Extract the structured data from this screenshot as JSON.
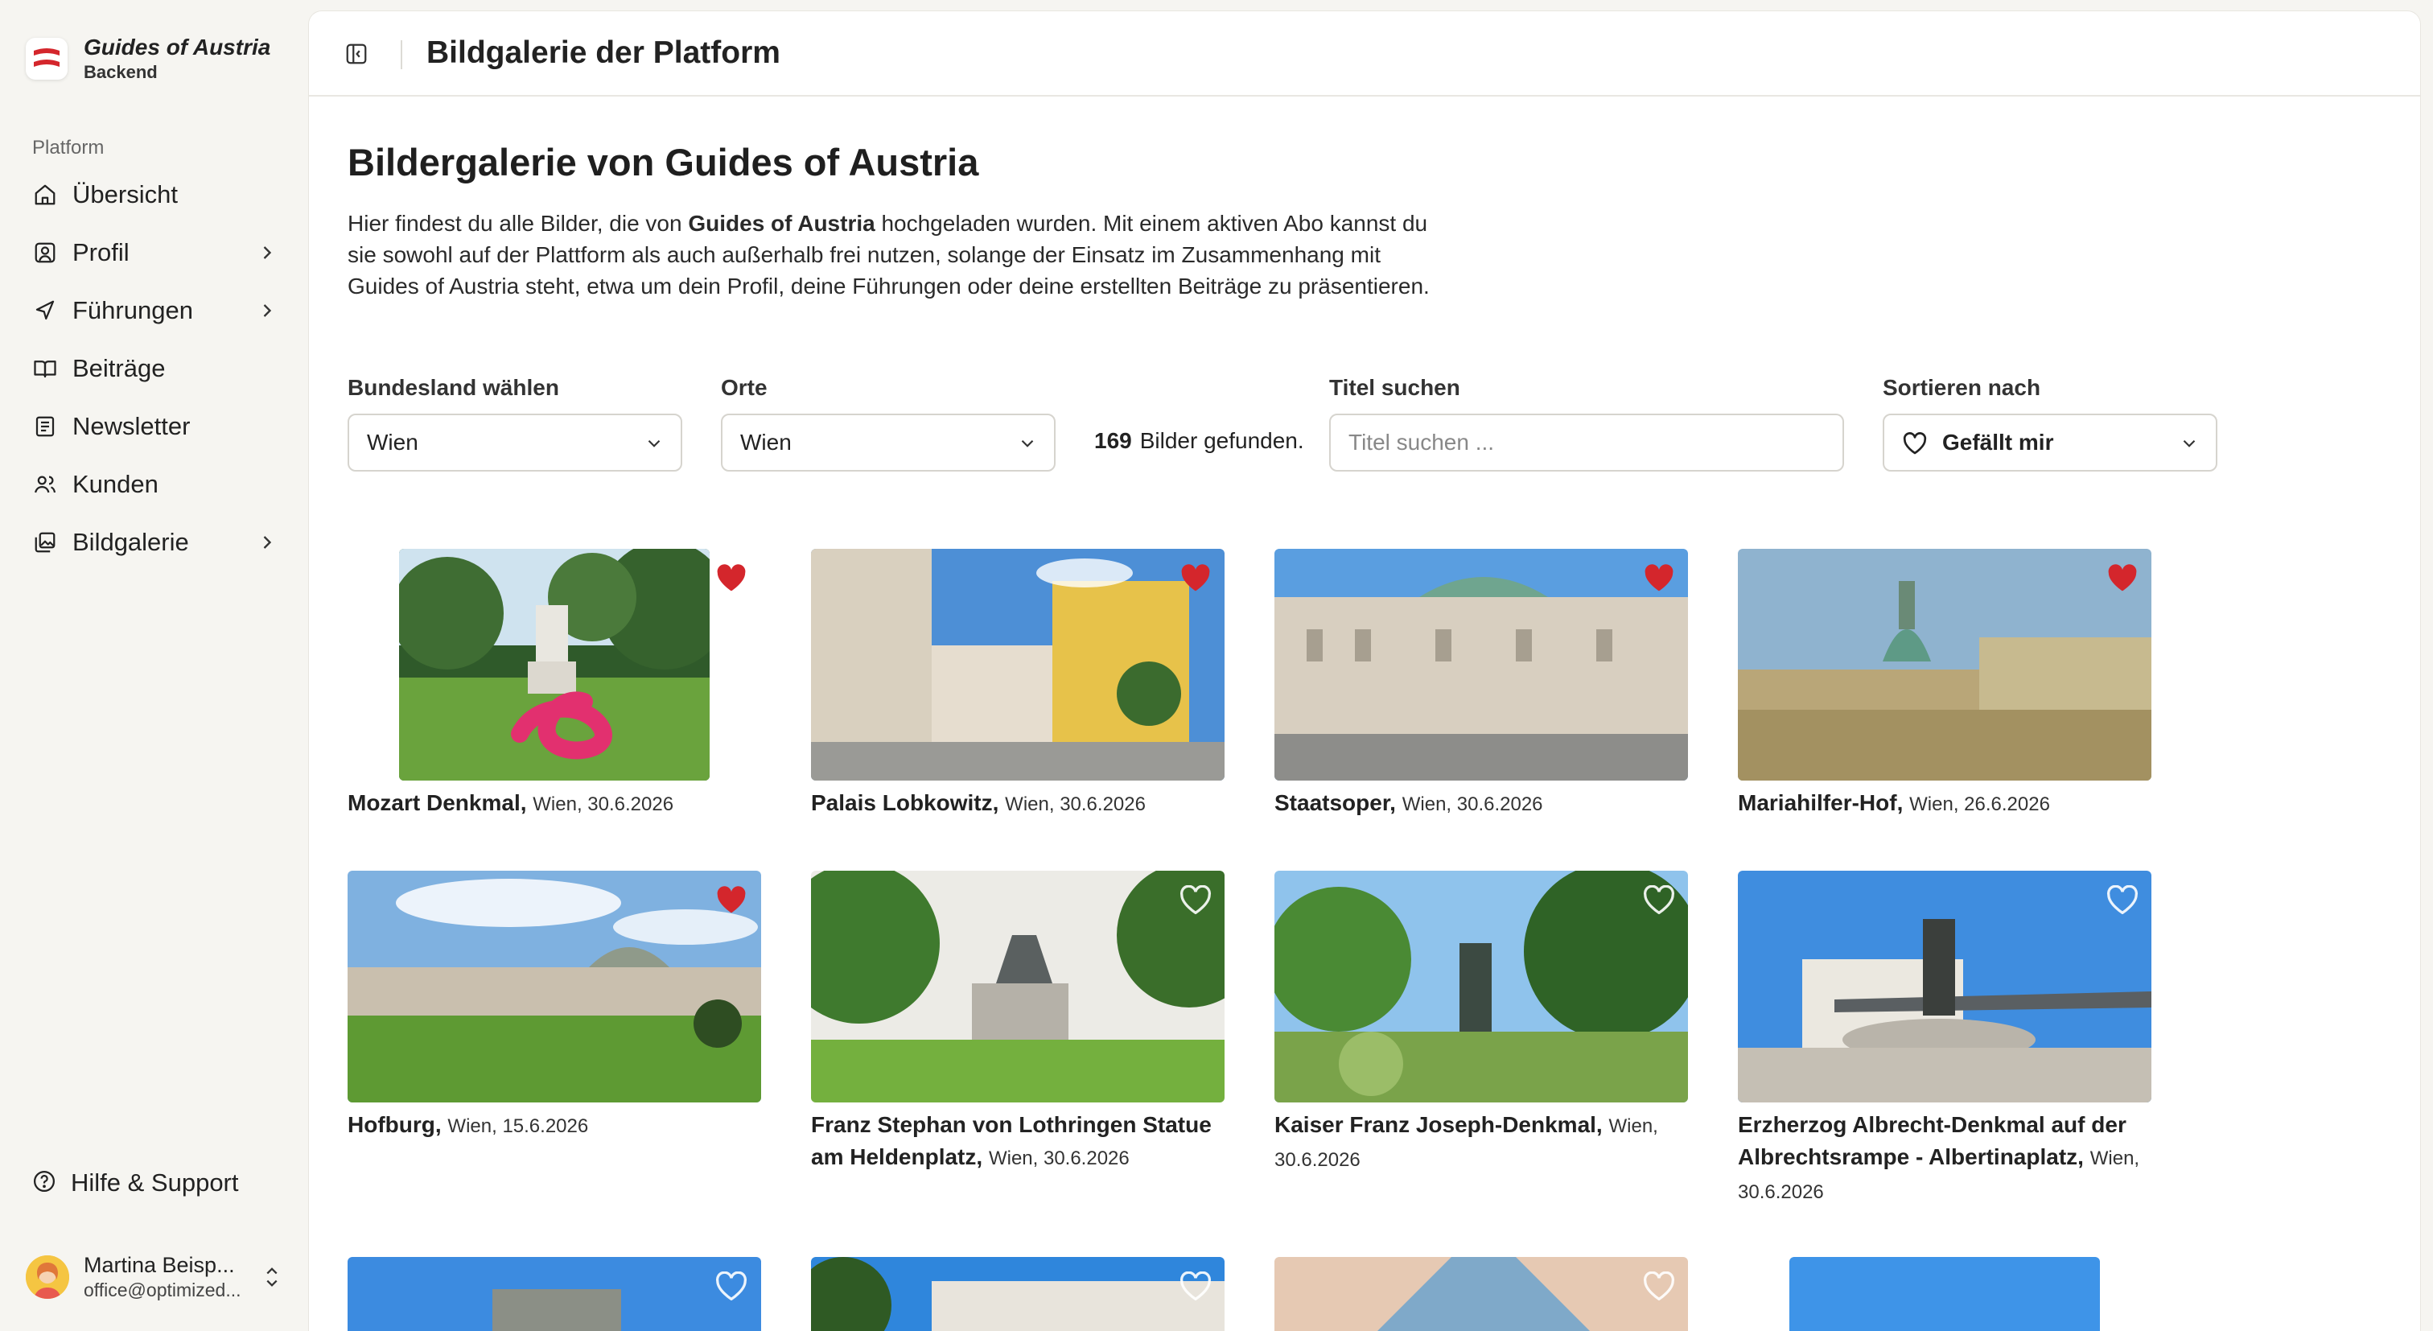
{
  "brand": {
    "title": "Guides of Austria",
    "subtitle": "Backend"
  },
  "nav": {
    "section_label": "Platform",
    "items": [
      {
        "label": "Übersicht",
        "icon": "home-icon"
      },
      {
        "label": "Profil",
        "icon": "profile-icon"
      },
      {
        "label": "Führungen",
        "icon": "navigation-icon"
      },
      {
        "label": "Beiträge",
        "icon": "book-icon"
      },
      {
        "label": "Newsletter",
        "icon": "newspaper-icon"
      },
      {
        "label": "Kunden",
        "icon": "users-icon"
      },
      {
        "label": "Bildgalerie",
        "icon": "gallery-icon"
      }
    ],
    "help_label": "Hilfe & Support"
  },
  "user": {
    "name": "Martina Beisp...",
    "email": "office@optimized..."
  },
  "topbar": {
    "title": "Bildgalerie der Platform"
  },
  "page": {
    "title": "Bildergalerie von Guides of Austria",
    "intro_1": "Hier findest du alle Bilder, die von ",
    "intro_bold": "Guides of Austria",
    "intro_2": " hochgeladen wurden. Mit einem aktiven Abo kannst du sie sowohl auf der Plattform als auch außerhalb frei nutzen, solange der Einsatz im Zusammenhang mit Guides of Austria steht, etwa um dein Profil, deine Führungen oder deine erstellten Beiträge zu präsentieren."
  },
  "filters": {
    "state_label": "Bundesland wählen",
    "state_value": "Wien",
    "place_label": "Orte",
    "place_value": "Wien",
    "count_number": "169",
    "count_text": "Bilder gefunden.",
    "search_label": "Titel suchen",
    "search_placeholder": "Titel suchen ...",
    "search_value": "",
    "sort_label": "Sortieren nach",
    "sort_value": "Gefällt mir"
  },
  "gallery": [
    {
      "title": "Mozart Denkmal,",
      "meta": "Wien,  30.6.2026",
      "liked": true
    },
    {
      "title": "Palais Lobkowitz,",
      "meta": "Wien,  30.6.2026",
      "liked": true
    },
    {
      "title": "Staatsoper,",
      "meta": "Wien,  30.6.2026",
      "liked": true
    },
    {
      "title": "Mariahilfer-Hof,",
      "meta": "Wien,  26.6.2026",
      "liked": true
    },
    {
      "title": "Hofburg,",
      "meta": "Wien,  15.6.2026",
      "liked": true
    },
    {
      "title": "Franz Stephan von Lothringen Statue am Heldenplatz,",
      "meta": "Wien,  30.6.2026",
      "liked": false
    },
    {
      "title": "Kaiser Franz Joseph-Denkmal,",
      "meta": "Wien,  30.6.2026",
      "liked": false
    },
    {
      "title": "Erzherzog Albrecht-Denkmal auf der Albrechtsrampe - Albertinaplatz,",
      "meta": "Wien,  30.6.2026",
      "liked": false
    },
    {
      "liked": false
    },
    {
      "liked": false
    },
    {
      "liked": false
    },
    {
      "liked": false
    }
  ],
  "colors": {
    "liked": "#d4262c",
    "unliked": "#ffffff",
    "background": "#f6f5f1",
    "brand_red": "#d4262c"
  }
}
